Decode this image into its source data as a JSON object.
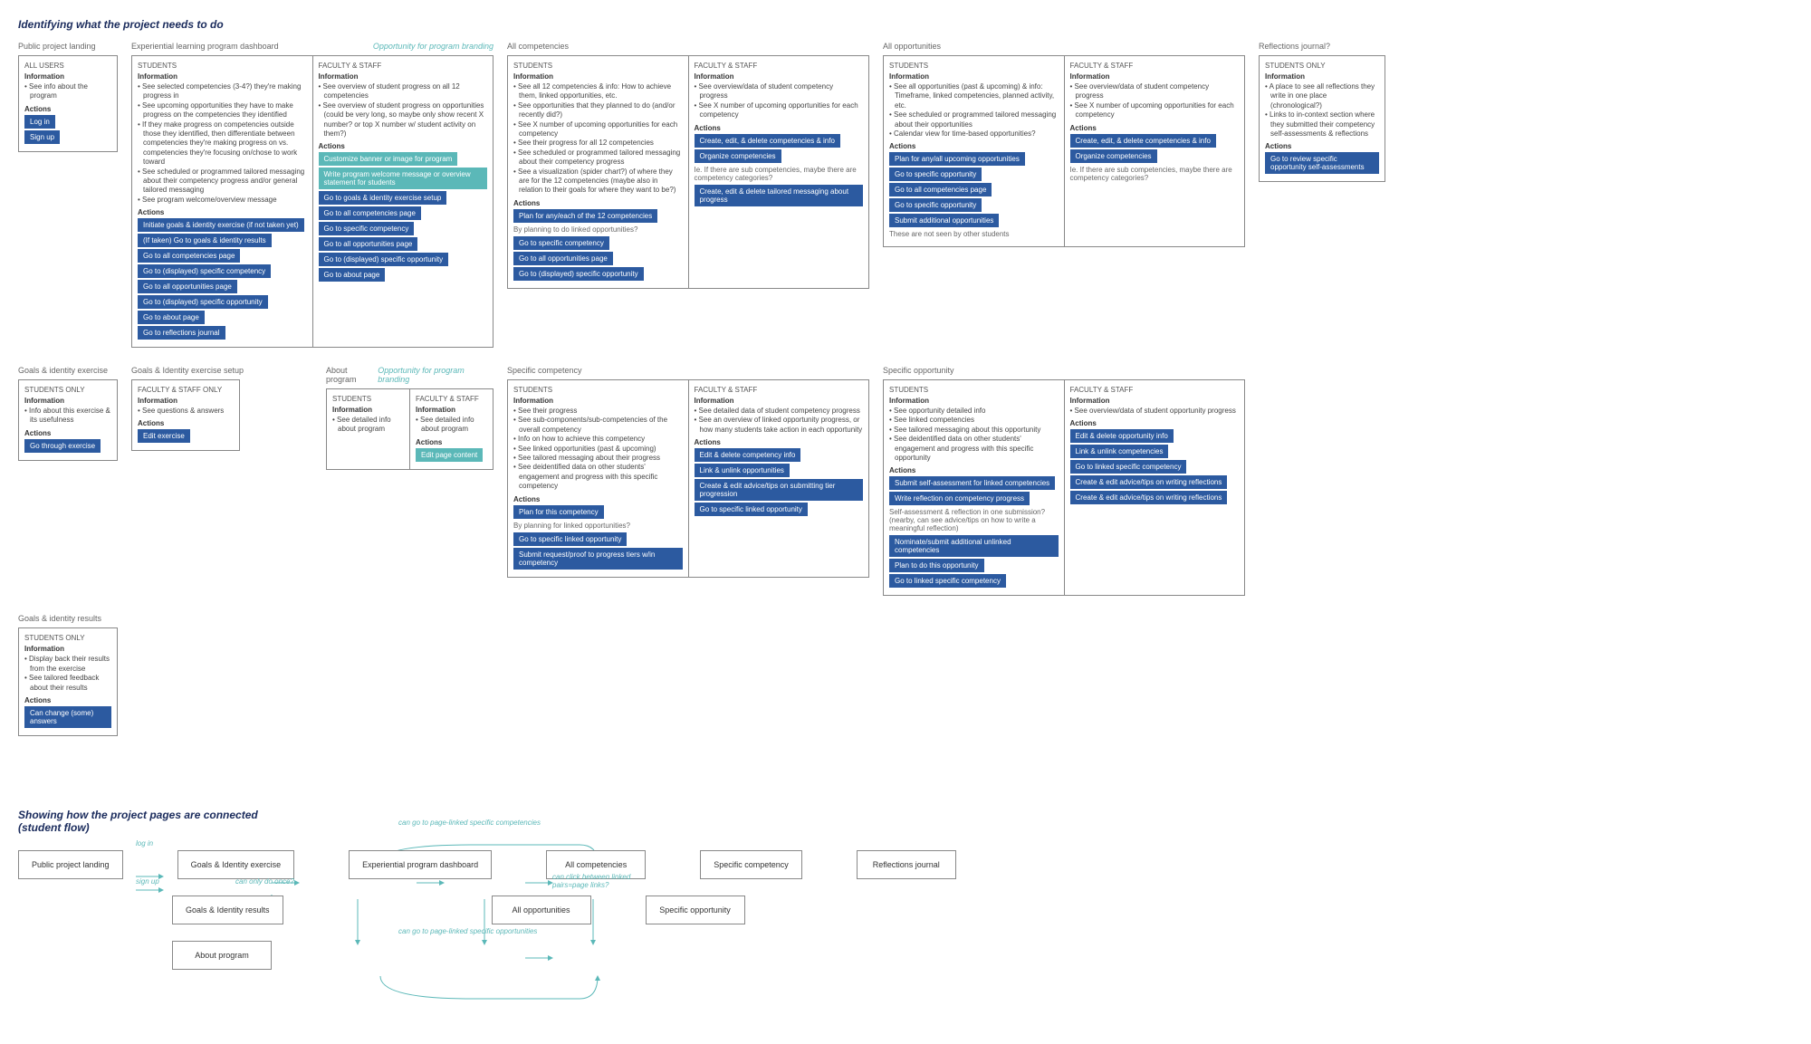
{
  "section1_title": "Identifying what the project needs to do",
  "section2_title": "Showing how the project pages are connected\n(student flow)",
  "labels": {
    "information": "Information",
    "actions": "Actions"
  },
  "columns": {
    "landing": {
      "title": "Public project landing"
    },
    "dashboard": {
      "title": "Experiential learning program dashboard",
      "branding": "Opportunity for program branding"
    },
    "competencies": {
      "title": "All competencies"
    },
    "opportunities": {
      "title": "All opportunities"
    },
    "reflections": {
      "title": "Reflections journal?"
    },
    "goals_exercise": {
      "title": "Goals & identity exercise"
    },
    "goals_setup": {
      "title": "Goals & Identity exercise setup"
    },
    "about": {
      "title": "About program",
      "branding": "Opportunity for program branding"
    },
    "spec_comp": {
      "title": "Specific competency"
    },
    "spec_opp": {
      "title": "Specific opportunity"
    },
    "goals_results": {
      "title": "Goals & identity results"
    }
  },
  "cards": {
    "landing": {
      "role": "ALL USERS",
      "info": [
        "See info about the program"
      ],
      "actions": [
        "Log in",
        "Sign up"
      ]
    },
    "dashboard_students": {
      "role": "STUDENTS",
      "info": [
        "See selected competencies (3-4?) they're making progress in",
        "See upcoming opportunities they have to make progress on the competencies they identified",
        "If they make progress on competencies outside those they identified, then differentiate between competencies they're making progress on vs. competencies they're focusing on/chose to work toward",
        "See scheduled or programmed tailored messaging about their competency progress and/or general tailored messaging",
        "See program welcome/overview message"
      ],
      "actions": [
        "Initiate goals & identity exercise (if not taken yet)",
        "(If taken) Go to goals & identity results",
        "Go to all competencies page",
        "Go to (displayed) specific competency",
        "Go to all opportunities page",
        "Go to (displayed) specific opportunity",
        "Go to about page",
        "Go to reflections journal"
      ]
    },
    "dashboard_faculty": {
      "role": "FACULTY & STAFF",
      "info": [
        "See overview of student progress on all 12 competencies",
        "See overview of student progress on opportunities (could be very long, so maybe only show recent X number? or top X number w/ student activity on them?)"
      ],
      "actions_teal": [
        "Customize banner or image for program",
        "Write program welcome message or overview statement for students"
      ],
      "actions": [
        "Go to goals & identity exercise setup",
        "Go to all competencies page",
        "Go to specific competency",
        "Go to all opportunities page",
        "Go to (displayed) specific opportunity",
        "Go to about page"
      ]
    },
    "competencies_students": {
      "role": "STUDENTS",
      "info": [
        "See all 12 competencies & info: How to achieve them, linked opportunities, etc.",
        "See opportunities that they planned to do (and/or recently did?)",
        "See X number of upcoming opportunities for each competency",
        "See their progress for all 12 competencies",
        "See scheduled or programmed tailored messaging about their competency progress",
        "See a visualization (spider chart?) of where they are for the 12 competencies (maybe also in relation to their goals for where they want to be?)"
      ],
      "actions": [
        "Plan for any/each of the 12 competencies"
      ],
      "note": "By planning to do linked opportunities?",
      "actions2": [
        "Go to specific competency",
        "Go to all opportunities page",
        "Go to (displayed) specific opportunity"
      ]
    },
    "competencies_faculty": {
      "role": "FACULTY & STAFF",
      "info": [
        "See overview/data of student competency progress",
        "See X number of upcoming opportunities for each competency"
      ],
      "actions": [
        "Create, edit, & delete competencies & info",
        "Organize competencies"
      ],
      "note": "Ie. If there are sub competencies, maybe there are competency categories?",
      "actions2": [
        "Create, edit & delete tailored messaging about progress"
      ]
    },
    "opportunities_students": {
      "role": "STUDENTS",
      "info": [
        "See all opportunities (past & upcoming) & info: Timeframe, linked competencies, planned activity, etc.",
        "See scheduled or programmed tailored messaging about their opportunities",
        "Calendar view for time-based opportunities?"
      ],
      "actions": [
        "Plan for any/all upcoming opportunities",
        "Go to specific opportunity",
        "Go to all competencies page",
        "Go to specific opportunity",
        "Submit additional opportunities"
      ],
      "note": "These are not seen by other students"
    },
    "opportunities_faculty": {
      "role": "FACULTY & STAFF",
      "info": [
        "See overview/data of student competency progress",
        "See X number of upcoming opportunities for each competency"
      ],
      "actions": [
        "Create, edit, & delete competencies & info",
        "Organize competencies"
      ],
      "note": "Ie. If there are sub competencies, maybe there are competency categories?"
    },
    "reflections": {
      "role": "STUDENTS ONLY",
      "info": [
        "A place to see all reflections they write in one place (chronological?)",
        "Links to in-context section where they submitted their competency self-assessments & reflections"
      ],
      "actions": [
        "Go to review specific opportunity self-assessments"
      ]
    },
    "goals_exercise": {
      "role": "STUDENTS ONLY",
      "info": [
        "Info about this exercise & its usefulness"
      ],
      "actions": [
        "Go through exercise"
      ]
    },
    "goals_setup": {
      "role": "FACULTY & STAFF ONLY",
      "info": [
        "See questions & answers"
      ],
      "actions": [
        "Edit exercise"
      ]
    },
    "about_students": {
      "role": "STUDENTS",
      "info": [
        "See detailed info about program"
      ]
    },
    "about_faculty": {
      "role": "FACULTY & STAFF",
      "info": [
        "See detailed info about program"
      ],
      "actions": [
        "Edit page content"
      ]
    },
    "spec_comp_students": {
      "role": "STUDENTS",
      "info": [
        "See their progress",
        "See sub-components/sub-competencies of the overall competency",
        "Info on how to achieve this competency",
        "See linked opportunities (past & upcoming)",
        "See tailored messaging about their progress",
        "See deidentified data on other students' engagement and progress with this specific competency"
      ],
      "actions": [
        "Plan for this competency"
      ],
      "note": "By planning for linked opportunities?",
      "actions2": [
        "Go to specific linked opportunity",
        "Submit request/proof to progress tiers w/in competency"
      ]
    },
    "spec_comp_faculty": {
      "role": "FACULTY & STAFF",
      "info": [
        "See detailed data of student competency progress",
        "See an overview of linked opportunity progress, or how many students take action in each opportunity"
      ],
      "actions": [
        "Edit & delete competency info",
        "Link & unlink opportunities",
        "Create & edit advice/tips on submitting tier progression",
        "Go to specific linked opportunity"
      ]
    },
    "spec_opp_students": {
      "role": "STUDENTS",
      "info": [
        "See opportunity detailed info",
        "See linked competencies",
        "See tailored messaging about this opportunity",
        "See deidentified data on other students' engagement and progress with this specific opportunity"
      ],
      "actions": [
        "Submit self-assessment for linked competencies",
        "Write reflection on competency progress"
      ],
      "note": "Self-assessment & reflection in one submission? (nearby, can see advice/tips on how to write a meaningful reflection)",
      "actions2": [
        "Nominate/submit additional unlinked competencies",
        "Plan to do this opportunity",
        "Go to linked specific competency"
      ]
    },
    "spec_opp_faculty": {
      "role": "FACULTY & STAFF",
      "info": [
        "See overview/data of student opportunity progress"
      ],
      "actions": [
        "Edit & delete opportunity info",
        "Link & unlink competencies",
        "Go to linked specific competency",
        "Create & edit advice/tips on writing reflections",
        "Create & edit advice/tips on writing reflections"
      ]
    },
    "goals_results": {
      "role": "STUDENTS ONLY",
      "info": [
        "Display back their results from the exercise",
        "See tailored feedback about their results"
      ],
      "actions": [
        "Can change (some) answers"
      ]
    }
  },
  "flow": {
    "boxes": {
      "landing": "Public project landing",
      "goals_ex": "Goals & Identity exercise",
      "dashboard": "Experiential program dashboard",
      "all_comp": "All competencies",
      "spec_comp": "Specific competency",
      "reflections": "Reflections journal",
      "goals_res": "Goals & Identity results",
      "all_opp": "All opportunities",
      "spec_opp": "Specific opportunity",
      "about": "About program"
    },
    "labels": {
      "login": "log in",
      "signup": "sign up",
      "once": "can only do once?",
      "goto_comp": "can go to page-linked specific competencies",
      "click_pairs": "can click between linked pairs=page links?",
      "goto_opp": "can go to page-linked specific opportunities"
    }
  }
}
